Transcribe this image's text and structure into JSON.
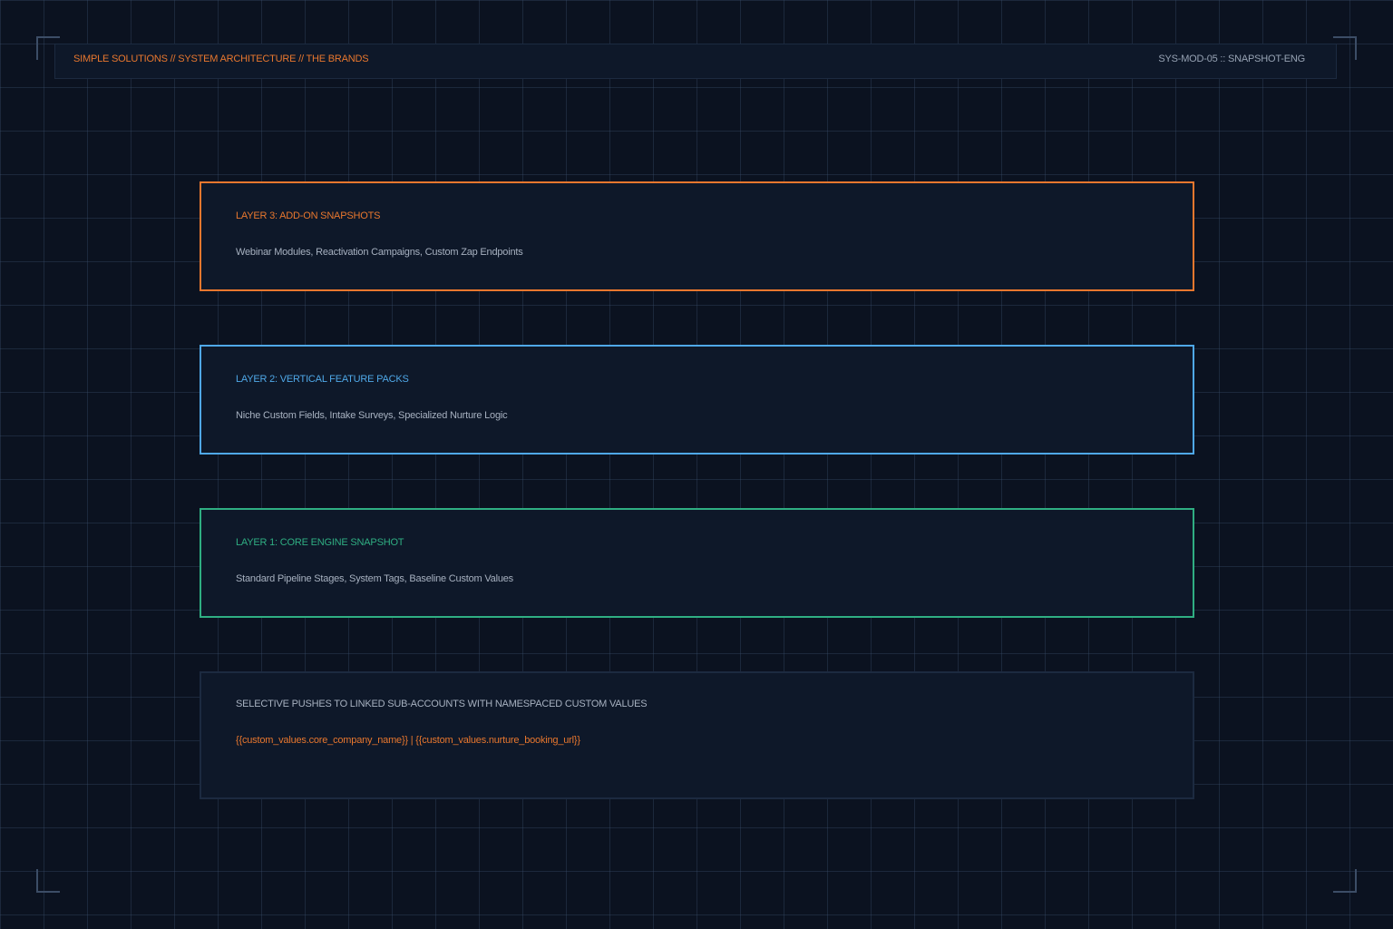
{
  "header": {
    "breadcrumb": "SIMPLE SOLUTIONS // SYSTEM ARCHITECTURE // THE BRANDS",
    "module_id": "SYS-MOD-05 :: SNAPSHOT-ENG"
  },
  "layers": [
    {
      "title": "LAYER 3: ADD-ON SNAPSHOTS",
      "description": "Webinar Modules, Reactivation Campaigns, Custom Zap Endpoints",
      "color": "#e8772e"
    },
    {
      "title": "LAYER 2: VERTICAL FEATURE PACKS",
      "description": "Niche Custom Fields, Intake Surveys, Specialized Nurture Logic",
      "color": "#4fa8e8"
    },
    {
      "title": "LAYER 1: CORE ENGINE SNAPSHOT",
      "description": "Standard Pipeline Stages, System Tags, Baseline Custom Values",
      "color": "#2fae82"
    }
  ],
  "push": {
    "title": "SELECTIVE PUSHES TO LINKED SUB-ACCOUNTS WITH NAMESPACED CUSTOM VALUES",
    "values": "{{custom_values.core_company_name}} | {{custom_values.nurture_booking_url}}"
  },
  "colors": {
    "background": "#0b1220",
    "panel": "#0e1829",
    "accent_orange": "#e8772e",
    "accent_blue": "#4fa8e8",
    "accent_green": "#2fae82",
    "text_muted": "#a7b1c0"
  }
}
